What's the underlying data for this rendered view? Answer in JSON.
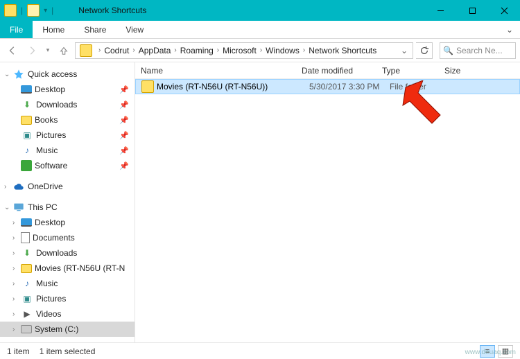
{
  "window": {
    "title": "Network Shortcuts"
  },
  "ribbon": {
    "file": "File",
    "tabs": [
      "Home",
      "Share",
      "View"
    ]
  },
  "breadcrumbs": [
    "Codrut",
    "AppData",
    "Roaming",
    "Microsoft",
    "Windows",
    "Network Shortcuts"
  ],
  "search": {
    "placeholder": "Search Ne..."
  },
  "nav": {
    "quick_access": {
      "label": "Quick access"
    },
    "quick_items": [
      {
        "label": "Desktop",
        "icon": "desktop",
        "pinned": true
      },
      {
        "label": "Downloads",
        "icon": "down",
        "pinned": true
      },
      {
        "label": "Books",
        "icon": "folder",
        "pinned": true
      },
      {
        "label": "Pictures",
        "icon": "pics",
        "pinned": true
      },
      {
        "label": "Music",
        "icon": "music",
        "pinned": true
      },
      {
        "label": "Software",
        "icon": "sw",
        "pinned": true
      }
    ],
    "onedrive": {
      "label": "OneDrive"
    },
    "thispc": {
      "label": "This PC"
    },
    "pc_items": [
      {
        "label": "Desktop",
        "icon": "desktop"
      },
      {
        "label": "Documents",
        "icon": "docs"
      },
      {
        "label": "Downloads",
        "icon": "down"
      },
      {
        "label": "Movies (RT-N56U (RT-N",
        "icon": "folder"
      },
      {
        "label": "Music",
        "icon": "music"
      },
      {
        "label": "Pictures",
        "icon": "pics"
      },
      {
        "label": "Videos",
        "icon": "vid"
      },
      {
        "label": "System (C:)",
        "icon": "disk",
        "selected": true
      }
    ]
  },
  "columns": {
    "name": "Name",
    "date": "Date modified",
    "type": "Type",
    "size": "Size"
  },
  "rows": [
    {
      "name": "Movies (RT-N56U (RT-N56U))",
      "date": "5/30/2017 3:30 PM",
      "type": "File folder",
      "size": "",
      "selected": true
    }
  ],
  "status": {
    "count": "1 item",
    "selected": "1 item selected"
  },
  "watermark": "www.deuaq.com"
}
